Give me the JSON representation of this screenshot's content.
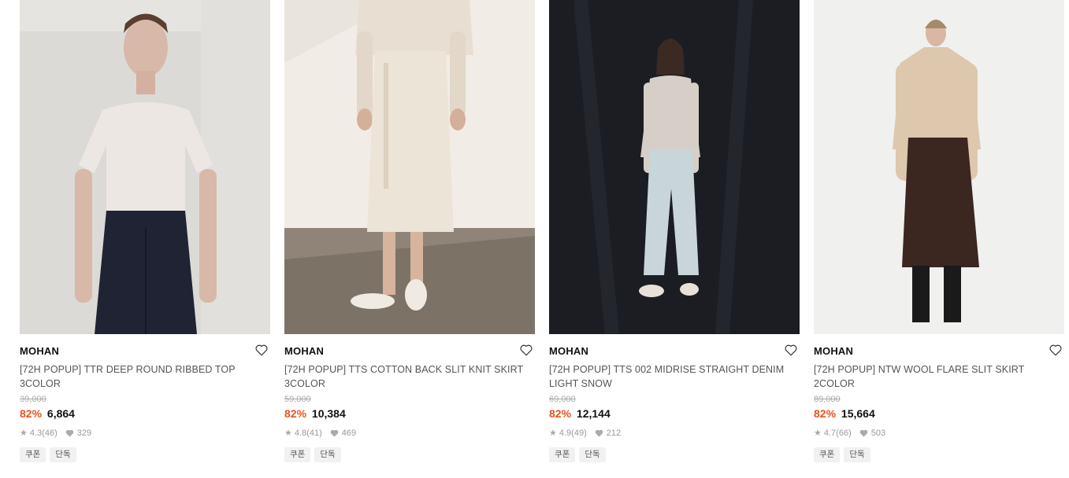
{
  "products": [
    {
      "brand": "MOHAN",
      "title": "[72H POPUP] TTR DEEP ROUND RIBBED TOP 3COLOR",
      "original_price": "39,000",
      "discount": "82%",
      "price": "6,864",
      "rating": "4.3",
      "reviews": "(46)",
      "likes": "329",
      "tags": [
        "쿠폰",
        "단독"
      ]
    },
    {
      "brand": "MOHAN",
      "title": "[72H POPUP] TTS COTTON BACK SLIT KNIT SKIRT 3COLOR",
      "original_price": "59,000",
      "discount": "82%",
      "price": "10,384",
      "rating": "4.8",
      "reviews": "(41)",
      "likes": "469",
      "tags": [
        "쿠폰",
        "단독"
      ]
    },
    {
      "brand": "MOHAN",
      "title": "[72H POPUP] TTS 002 MIDRISE STRAIGHT DENIM LIGHT SNOW",
      "original_price": "69,000",
      "discount": "82%",
      "price": "12,144",
      "rating": "4.9",
      "reviews": "(49)",
      "likes": "212",
      "tags": [
        "쿠폰",
        "단독"
      ]
    },
    {
      "brand": "MOHAN",
      "title": "[72H POPUP] NTW WOOL FLARE SLIT SKIRT 2COLOR",
      "original_price": "89,000",
      "discount": "82%",
      "price": "15,664",
      "rating": "4.7",
      "reviews": "(66)",
      "likes": "503",
      "tags": [
        "쿠폰",
        "단독"
      ]
    }
  ],
  "colors": {
    "discount": "#e8541e",
    "tag_bg": "#f1f1f1"
  },
  "icons": {
    "wishlist": "heart-outline-icon",
    "rating": "star-icon",
    "likes": "heart-filled-icon"
  }
}
